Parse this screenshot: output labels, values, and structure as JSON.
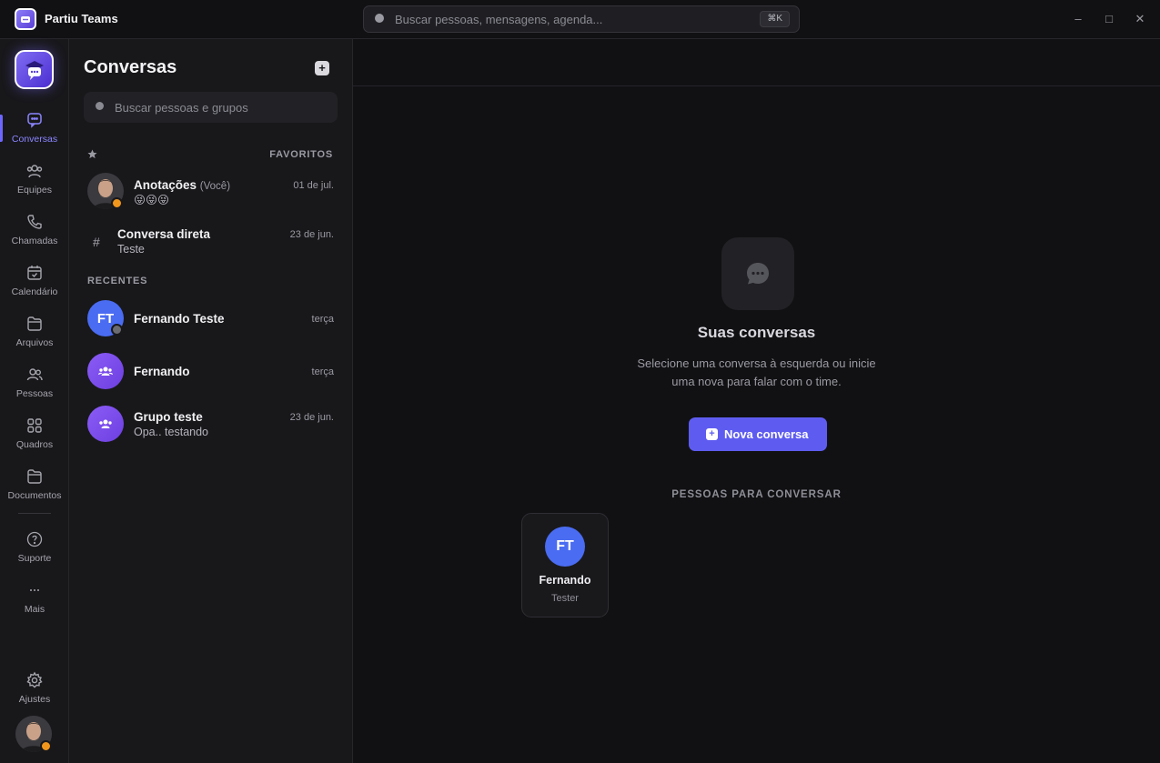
{
  "app": {
    "title": "Partiu Teams",
    "global_search_placeholder": "Buscar pessoas, mensagens, agenda...",
    "shortcut": "⌘K",
    "window_controls": {
      "minimize": "–",
      "maximize": "□",
      "close": "✕"
    }
  },
  "rail": {
    "items": [
      {
        "label": "Conversas",
        "icon": "chat-icon",
        "active": true
      },
      {
        "label": "Equipes",
        "icon": "team-icon"
      },
      {
        "label": "Chamadas",
        "icon": "phone-icon"
      },
      {
        "label": "Calendário",
        "icon": "calendar-icon"
      },
      {
        "label": "Arquivos",
        "icon": "folder-icon"
      },
      {
        "label": "Pessoas",
        "icon": "people-icon"
      },
      {
        "label": "Quadros",
        "icon": "grid-icon"
      },
      {
        "label": "Documentos",
        "icon": "document-folder-icon"
      },
      {
        "label": "Suporte",
        "icon": "help-icon"
      },
      {
        "label": "Mais",
        "icon": "more-icon"
      },
      {
        "label": "Ajustes",
        "icon": "gear-icon"
      }
    ],
    "accent_color": "#6d66ff"
  },
  "conversations_panel": {
    "title": "Conversas",
    "search_placeholder": "Buscar pessoas e grupos",
    "favorites_label": "FAVORITOS",
    "recents_label": "RECENTES",
    "favorites": [
      {
        "name": "Anotações",
        "suffix": "(Você)",
        "preview": "😜😜😜",
        "time": "01 de jul."
      },
      {
        "name": "Conversa direta",
        "preview": "Teste",
        "time": "23 de jun."
      }
    ],
    "recents": [
      {
        "name": "Fernando Teste",
        "initials": "FT",
        "time": "terça",
        "preview": ""
      },
      {
        "name": "Fernando",
        "time": "terça",
        "preview": ""
      },
      {
        "name": "Grupo teste",
        "time": "23 de jun.",
        "preview": "Opa.. testando"
      }
    ]
  },
  "main": {
    "empty_title": "Suas conversas",
    "empty_desc_line1": "Selecione uma conversa à esquerda ou inicie",
    "empty_desc_line2": "uma nova para falar com o time.",
    "new_button": "Nova conversa",
    "people_label": "PESSOAS PARA CONVERSAR",
    "people": [
      {
        "initials": "FT",
        "name": "Fernando",
        "role": "Tester"
      }
    ],
    "button_color": "#5e5cf0"
  }
}
